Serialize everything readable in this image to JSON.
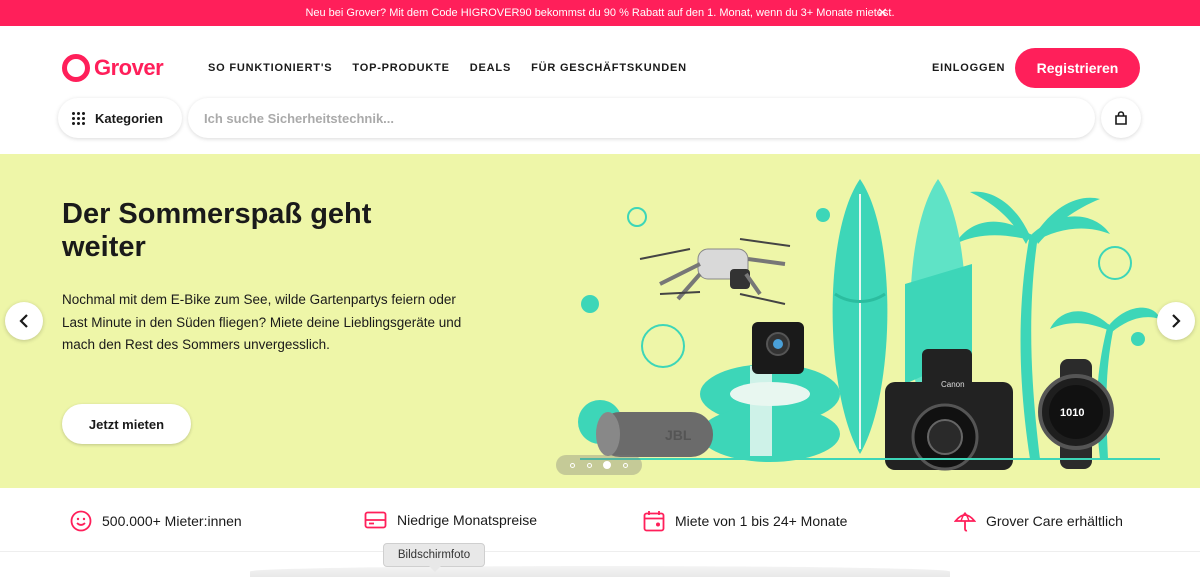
{
  "promo": {
    "text": "Neu bei Grover? Mit dem Code HIGROVER90 bekommst du 90 % Rabatt auf den 1. Monat, wenn du 3+ Monate mietest.",
    "close": "✕"
  },
  "header": {
    "logo": "Grover",
    "nav": [
      "SO FUNKTIONIERT'S",
      "TOP-PRODUKTE",
      "DEALS",
      "FÜR GESCHÄFTSKUNDEN"
    ],
    "login": "EINLOGGEN",
    "register": "Registrieren",
    "categories": "Kategorien",
    "search_placeholder": "Ich suche Sicherheitstechnik..."
  },
  "hero": {
    "title": "Der Sommerspaß geht weiter",
    "text": "Nochmal mit dem E-Bike zum See, wilde Gartenpartys feiern oder Last Minute in den Süden fliegen? Miete deine Lieblingsgeräte und mach den Rest des Sommers unvergesslich.",
    "cta": "Jetzt mieten",
    "slides": 4,
    "active_slide": 3
  },
  "features": [
    {
      "icon": "smiley-icon",
      "text": "500.000+ Mieter:innen"
    },
    {
      "icon": "card-icon",
      "text": "Niedrige Monatspreise"
    },
    {
      "icon": "calendar-icon",
      "text": "Miete von 1 bis 24+ Monate"
    },
    {
      "icon": "umbrella-icon",
      "text": "Grover Care erhältlich"
    }
  ],
  "tooltip": "Bildschirmfoto",
  "colors": {
    "brand": "#ff1f5a",
    "hero_bg": "#eef6a8",
    "teal": "#3dd6b8"
  }
}
